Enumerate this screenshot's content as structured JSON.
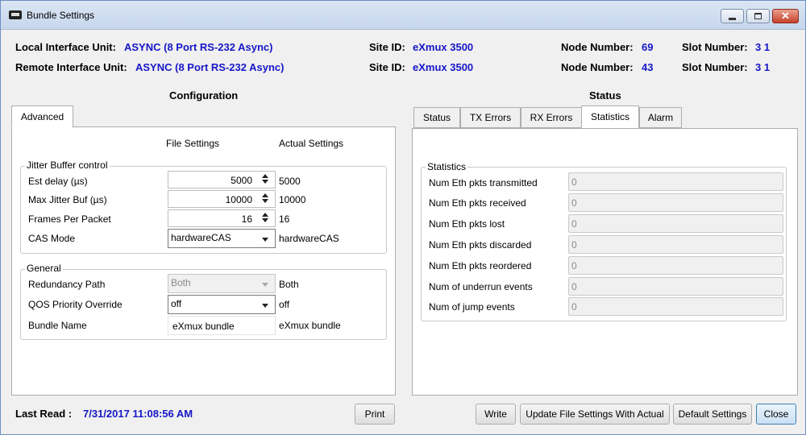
{
  "window": {
    "title": "Bundle Settings"
  },
  "header": {
    "local_label": "Local Interface Unit:",
    "local_value": "ASYNC (8 Port RS-232 Async)",
    "remote_label": "Remote Interface Unit:",
    "remote_value": "ASYNC (8 Port RS-232 Async)",
    "site_label": "Site ID:",
    "local_site": "eXmux 3500",
    "remote_site": "eXmux 3500",
    "node_label": "Node Number:",
    "local_node": "69",
    "remote_node": "43",
    "slot_label": "Slot Number:",
    "local_slot": "3 1",
    "remote_slot": "3 1"
  },
  "configuration": {
    "title": "Configuration",
    "tab": "Advanced",
    "col_file": "File Settings",
    "col_actual": "Actual Settings",
    "jitter": {
      "legend": "Jitter Buffer control",
      "rows": [
        {
          "label": "Est delay (µs)",
          "file": "5000",
          "actual": "5000"
        },
        {
          "label": "Max Jitter Buf (µs)",
          "file": "10000",
          "actual": "10000"
        },
        {
          "label": "Frames Per Packet",
          "file": "16",
          "actual": "16"
        },
        {
          "label": "CAS Mode",
          "file": "hardwareCAS",
          "actual": "hardwareCAS"
        }
      ]
    },
    "general": {
      "legend": "General",
      "rows": [
        {
          "label": "Redundancy Path",
          "file": "Both",
          "actual": "Both"
        },
        {
          "label": "QOS Priority Override",
          "file": "off",
          "actual": "off"
        },
        {
          "label": "Bundle Name",
          "file": "eXmux bundle",
          "actual": "eXmux bundle"
        }
      ]
    }
  },
  "status": {
    "title": "Status",
    "tabs": [
      "Status",
      "TX Errors",
      "RX Errors",
      "Statistics",
      "Alarm"
    ],
    "active_tab": "Statistics",
    "statistics": {
      "legend": "Statistics",
      "rows": [
        {
          "label": "Num Eth pkts transmitted",
          "value": "0"
        },
        {
          "label": "Num Eth pkts received",
          "value": "0"
        },
        {
          "label": "Num Eth pkts lost",
          "value": "0"
        },
        {
          "label": "Num Eth pkts discarded",
          "value": "0"
        },
        {
          "label": "Num Eth pkts reordered",
          "value": "0"
        },
        {
          "label": "Num of underrun events",
          "value": "0"
        },
        {
          "label": "Num of jump events",
          "value": "0"
        }
      ]
    }
  },
  "footer": {
    "last_read_label": "Last Read :",
    "last_read_value": "7/31/2017 11:08:56 AM",
    "print": "Print",
    "write": "Write",
    "update": "Update File Settings With Actual",
    "default": "Default Settings",
    "close": "Close"
  },
  "colors": {
    "value_blue": "#1616c8",
    "accent": "#3c7fb1"
  }
}
